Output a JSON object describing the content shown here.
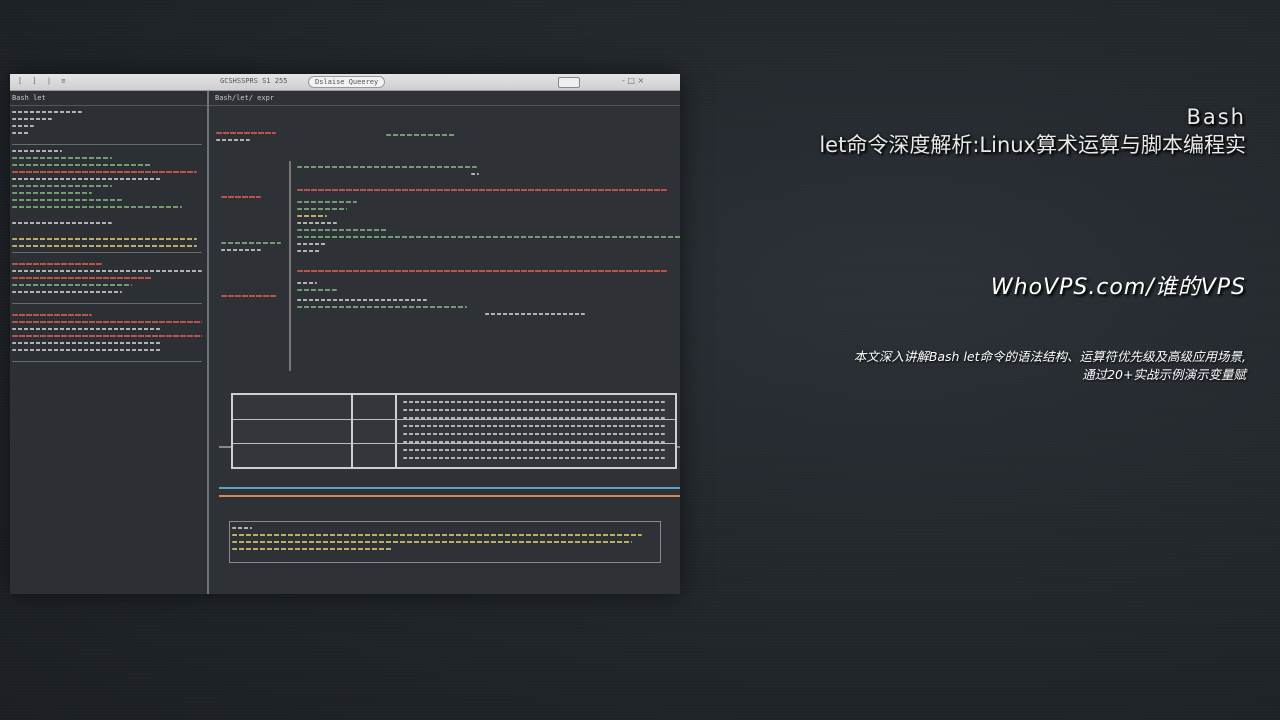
{
  "screenshot": {
    "titlebar": {
      "left_text": "[ ] |  ≡ ",
      "tab_text": "GCSHSSPRS S1 255",
      "tab2_text": "Dslaise Queerey",
      "controls": "- □ ×"
    },
    "sidebar": {
      "header": "Bash let",
      "accent_colors": [
        "#7fb07a",
        "#d25a4e",
        "#c9c9c9",
        "#d7c36a"
      ]
    },
    "editor": {
      "header": "Bash/let/ expr"
    }
  },
  "title": {
    "line1": "Bash",
    "line2": "let命令深度解析:Linux算术运算与脚本编程实"
  },
  "site": {
    "label": "WhoVPS.com/谁的VPS"
  },
  "description": {
    "line1": "本文深入讲解Bash let命令的语法结构、运算符优先级及高级应用场景,",
    "line2": "通过20+实战示例演示变量赋"
  }
}
